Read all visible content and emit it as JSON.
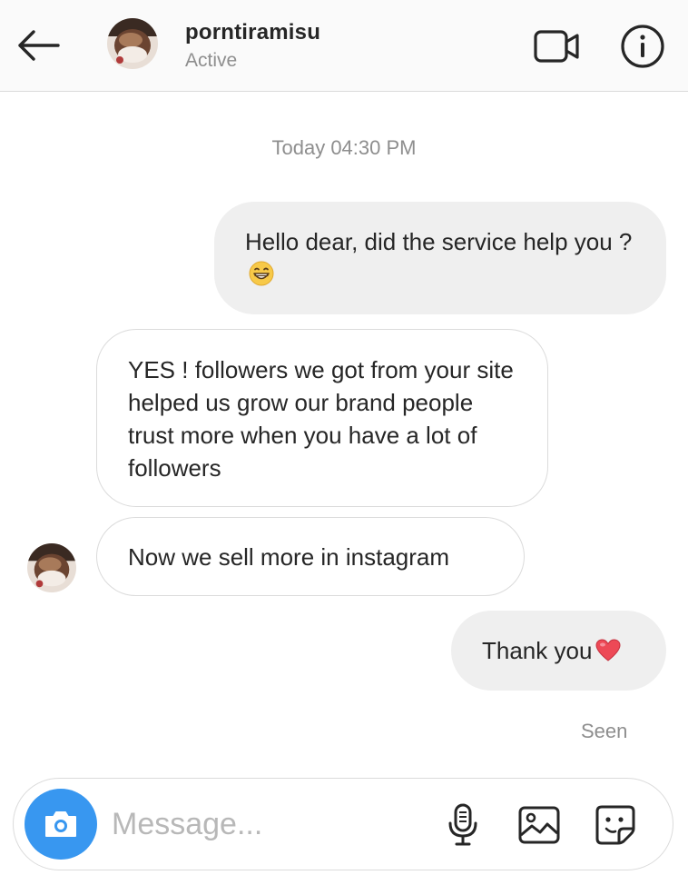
{
  "header": {
    "username": "porntiramisu",
    "status": "Active",
    "icons": {
      "back": "back-arrow-icon",
      "video": "video-camera-icon",
      "info": "info-icon"
    }
  },
  "thread": {
    "timestamp": "Today 04:30 PM",
    "messages": [
      {
        "direction": "sent",
        "text": "Hello dear, did the service help you ?",
        "emoji": "😁"
      },
      {
        "direction": "received",
        "text": "YES ! followers we got from your site helped us grow our brand people trust more when you have a lot of followers"
      },
      {
        "direction": "received",
        "text": "Now we sell more in instagram"
      },
      {
        "direction": "sent",
        "text": "Thank you",
        "emoji": "❤️"
      }
    ],
    "seen_label": "Seen"
  },
  "composer": {
    "placeholder": "Message...",
    "value": "",
    "icons": {
      "camera": "camera-icon",
      "mic": "microphone-icon",
      "gallery": "image-icon",
      "sticker": "sticker-icon"
    }
  },
  "colors": {
    "header_bg": "#fafafa",
    "sent_bubble": "#efefef",
    "received_border": "#dbdbdb",
    "secondary_text": "#8e8e8e",
    "camera_button": "#3897f0",
    "heart": "#ed4956"
  }
}
